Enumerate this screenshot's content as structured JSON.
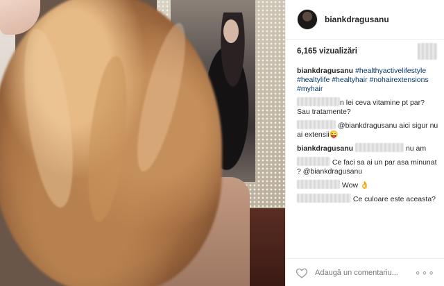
{
  "post": {
    "username": "biankdragusanu",
    "views_label": "6,165 vizualizări"
  },
  "caption": {
    "author": "biankdragusanu",
    "hashtags": "#healthyactivelifestyle #healtylife #healtyhair #nohairextensions #myhair"
  },
  "comments": [
    {
      "text": "n lei ceva vitamine pt par? Sau tratamente?"
    },
    {
      "text": "@biankdragusanu aici sigur nu ai extensii",
      "emoji": "😜"
    },
    {
      "author": "biankdragusanu",
      "text": "nu am"
    },
    {
      "text": "Ce faci sa ai un par asa minunat ? @biankdragusanu"
    },
    {
      "text": "Wow",
      "emoji": "👌"
    },
    {
      "text": "Ce culoare este aceasta?"
    }
  ],
  "footer": {
    "add_comment_placeholder": "Adaugă un comentariu...",
    "more_label": "∘∘∘"
  },
  "icons": {
    "like": "heart-icon",
    "options": "more-options-icon"
  },
  "colors": {
    "hashtag": "#003569",
    "border": "#efefef"
  }
}
